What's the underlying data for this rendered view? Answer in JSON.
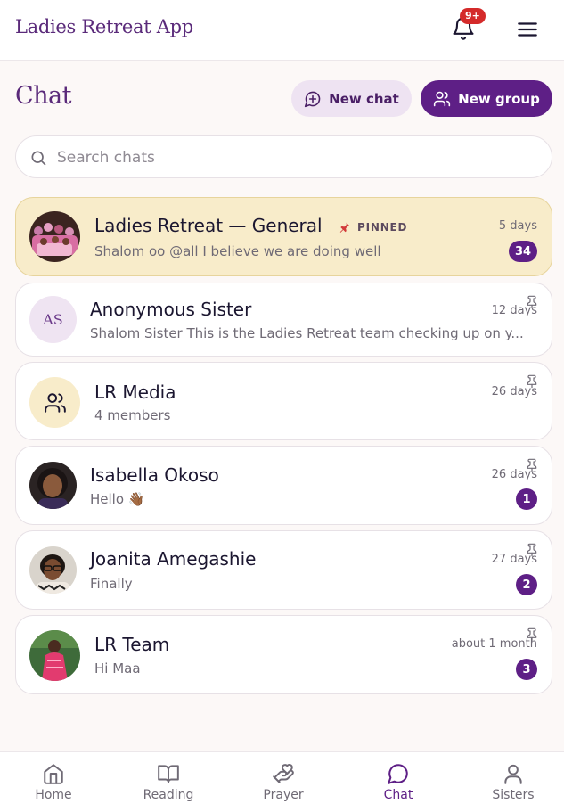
{
  "header": {
    "app_title": "Ladies Retreat App",
    "notification_badge": "9+",
    "bell_icon": "bell-icon",
    "menu_icon": "hamburger-menu-icon"
  },
  "page": {
    "title": "Chat",
    "new_chat_label": "New chat",
    "new_group_label": "New group"
  },
  "search": {
    "placeholder": "Search chats",
    "value": ""
  },
  "chats": [
    {
      "name": "Ladies Retreat — General",
      "pinned_label": "PINNED",
      "preview": "Shalom oo @all I believe we are doing well",
      "time": "5 days",
      "unread": "34",
      "avatar": "group-photo"
    },
    {
      "name": "Anonymous Sister",
      "initials": "AS",
      "preview": "Shalom Sister This is the Ladies Retreat team checking up on y...",
      "time": "12 days"
    },
    {
      "name": "LR Media",
      "preview": "4 members",
      "time": "26 days",
      "avatar": "users-icon"
    },
    {
      "name": "Isabella Okoso",
      "preview": "Hello 👋🏾",
      "time": "26 days",
      "unread": "1"
    },
    {
      "name": "Joanita Amegashie",
      "preview": "Finally",
      "time": "27 days",
      "unread": "2"
    },
    {
      "name": "LR Team",
      "preview": "Hi Maa",
      "time": "about 1 month",
      "unread": "3"
    }
  ],
  "nav": [
    {
      "label": "Home",
      "icon": "home-icon"
    },
    {
      "label": "Reading",
      "icon": "book-icon"
    },
    {
      "label": "Prayer",
      "icon": "praying-hands-icon"
    },
    {
      "label": "Chat",
      "icon": "chat-bubble-icon",
      "active": true
    },
    {
      "label": "Sisters",
      "icon": "person-icon"
    }
  ],
  "colors": {
    "brand_purple": "#5e1f86",
    "pinned_background": "#f8ecca",
    "notification_red": "#d42a2a"
  }
}
